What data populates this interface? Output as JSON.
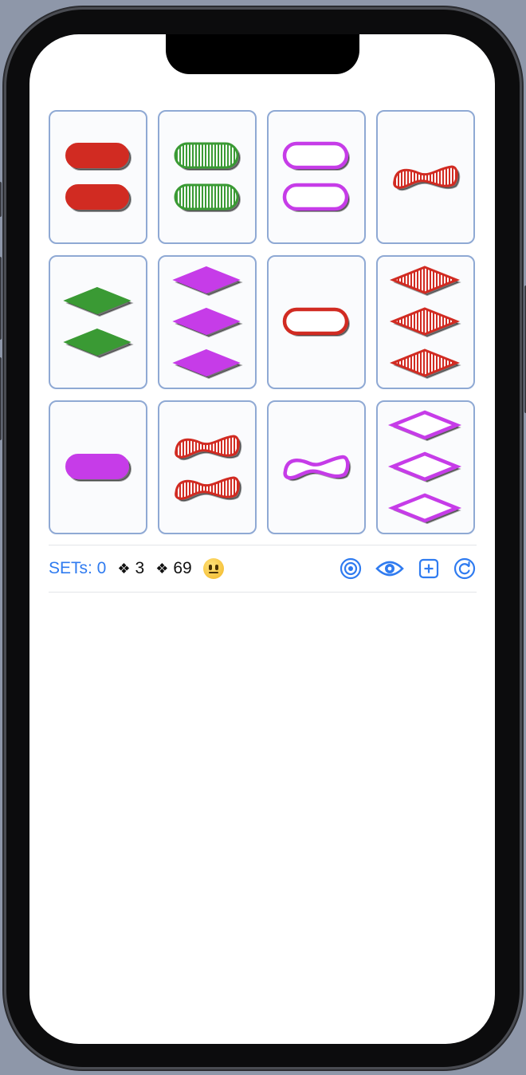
{
  "colors": {
    "accent": "#2f7bf0",
    "red": "#d12b22",
    "green": "#3a9a34",
    "purple": "#c63ce8",
    "card_border": "#8fa9d4"
  },
  "cards": [
    {
      "count": 2,
      "shape": "oval",
      "color": "red",
      "fill": "solid"
    },
    {
      "count": 2,
      "shape": "oval",
      "color": "green",
      "fill": "striped"
    },
    {
      "count": 2,
      "shape": "oval",
      "color": "purple",
      "fill": "open"
    },
    {
      "count": 1,
      "shape": "squiggle",
      "color": "red",
      "fill": "striped"
    },
    {
      "count": 2,
      "shape": "diamond",
      "color": "green",
      "fill": "solid"
    },
    {
      "count": 3,
      "shape": "diamond",
      "color": "purple",
      "fill": "solid"
    },
    {
      "count": 1,
      "shape": "oval",
      "color": "red",
      "fill": "open"
    },
    {
      "count": 3,
      "shape": "diamond",
      "color": "red",
      "fill": "striped"
    },
    {
      "count": 1,
      "shape": "oval",
      "color": "purple",
      "fill": "solid"
    },
    {
      "count": 2,
      "shape": "squiggle",
      "color": "red",
      "fill": "striped"
    },
    {
      "count": 1,
      "shape": "squiggle",
      "color": "purple",
      "fill": "open"
    },
    {
      "count": 3,
      "shape": "diamond",
      "color": "purple",
      "fill": "open"
    }
  ],
  "status": {
    "sets_label": "SETs: 0",
    "glyph": "❖",
    "hints": "3",
    "deck": "69",
    "mood_icon": "neutral-face-emoji"
  },
  "toolbar_icons": [
    "target-icon",
    "eye-icon",
    "plus-square-icon",
    "refresh-icon"
  ]
}
